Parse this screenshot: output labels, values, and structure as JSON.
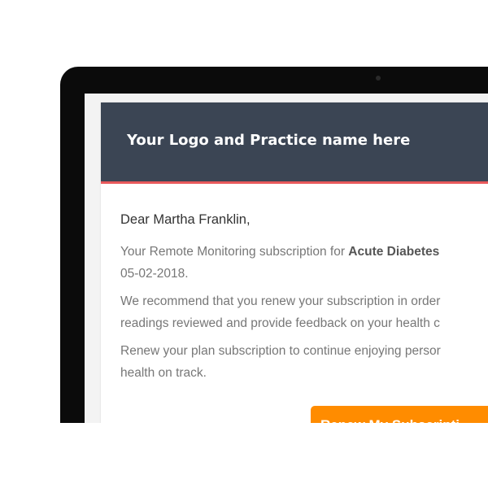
{
  "email": {
    "header": {
      "logo_text": "Your Logo and Practice name here",
      "background_color": "#3b4554",
      "accent_line_color": "#e8595b"
    },
    "greeting": "Dear Martha Franklin,",
    "paragraph_1": {
      "line_1_prefix": "Your Remote Monitoring subscription for ",
      "line_1_bold": "Acute Diabetes",
      "line_2": "05-02-2018."
    },
    "paragraph_2": {
      "line_1": "We recommend that you renew your subscription in order",
      "line_2": "readings reviewed and provide feedback on your health c"
    },
    "paragraph_3": {
      "line_1": "Renew your plan subscription to continue enjoying persor",
      "line_2": "health on track."
    },
    "renew_button": {
      "label": "Renew My Subscripti",
      "color": "#ff8c00"
    }
  },
  "device": {
    "camera_icon": "camera-dot"
  }
}
